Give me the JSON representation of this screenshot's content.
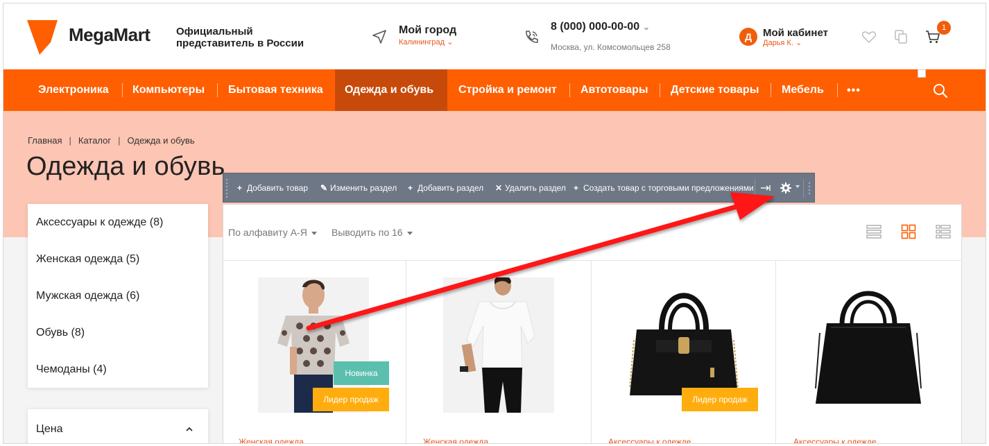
{
  "header": {
    "brand": "MegaMart",
    "tagline": "Официальный представитель в России",
    "city_title": "Мой город",
    "city_value": "Калининград",
    "phone": "8 (000) 000-00-00",
    "address": "Москва, ул. Комсомольцев 258",
    "avatar_letter": "Д",
    "cabinet_label": "Мой кабинет",
    "user_name": "Дарья К.",
    "cart_count": "1"
  },
  "nav": {
    "items": [
      {
        "label": "Электроника"
      },
      {
        "label": "Компьютеры"
      },
      {
        "label": "Бытовая техника"
      },
      {
        "label": "Одежда и обувь",
        "active": true
      },
      {
        "label": "Стройка и ремонт"
      },
      {
        "label": "Автотовары"
      },
      {
        "label": "Детские товары"
      },
      {
        "label": "Мебель"
      }
    ],
    "more": "•••"
  },
  "breadcrumb": [
    "Главная",
    "Каталог",
    "Одежда и обувь"
  ],
  "page_title": "Одежда и обувь",
  "sidebar": {
    "items": [
      {
        "label": "Аксессуары к одежде (8)"
      },
      {
        "label": "Женская одежда (5)"
      },
      {
        "label": "Мужская одежда (6)"
      },
      {
        "label": "Обувь (8)"
      },
      {
        "label": "Чемоданы (4)"
      }
    ],
    "price_label": "Цена"
  },
  "admin_toolbar": {
    "buttons": [
      {
        "icon": "+",
        "label": "Добавить товар"
      },
      {
        "icon": "✎",
        "label": "Изменить раздел"
      },
      {
        "icon": "+",
        "label": "Добавить раздел"
      },
      {
        "icon": "✕",
        "label": "Удалить раздел"
      },
      {
        "icon": "+",
        "label": "Создать товар с торговыми предложениями"
      }
    ]
  },
  "listing": {
    "sort_label": "По алфавиту А-Я",
    "per_page_label": "Выводить по 16"
  },
  "products": [
    {
      "category": "Женская одежда",
      "badges": [
        "Новинка",
        "Лидер продаж"
      ]
    },
    {
      "category": "Женская одежда",
      "badges": []
    },
    {
      "category": "Аксессуары к одежде",
      "badges": [
        "Лидер продаж"
      ]
    },
    {
      "category": "Аксессуары к одежде",
      "badges": []
    }
  ],
  "colors": {
    "accent": "#ff5f00",
    "accent_dark": "#c84a0a",
    "band": "#fdc5b3",
    "toolbar": "#6e7785",
    "badge_new": "#5bbfae",
    "badge_hit": "#ffad0e",
    "arrow": "#ff1414"
  }
}
